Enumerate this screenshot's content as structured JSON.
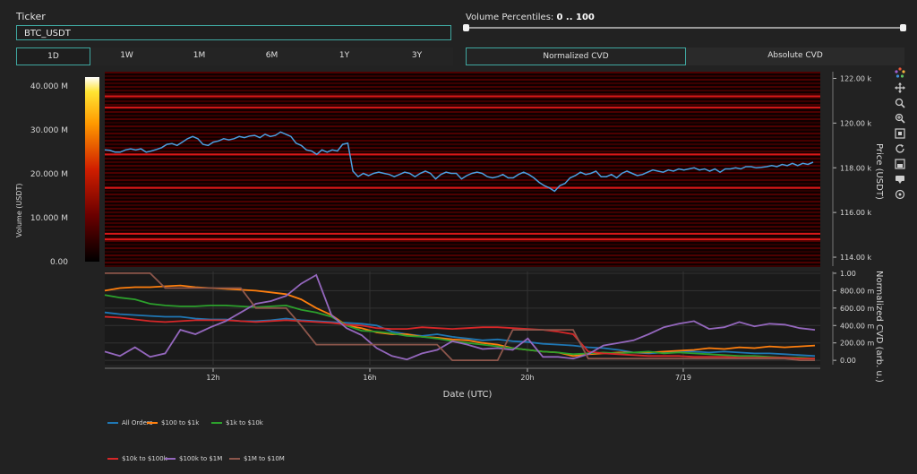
{
  "ticker": {
    "label": "Ticker",
    "value": "BTC_USDT"
  },
  "ranges": [
    "1D",
    "1W",
    "1M",
    "6M",
    "1Y",
    "3Y"
  ],
  "active_range": "1D",
  "volume_percentiles": {
    "label": "Volume Percentiles:",
    "value": "0 .. 100"
  },
  "cvd_modes": [
    "Normalized CVD",
    "Absolute CVD"
  ],
  "active_cvd_mode": "Normalized CVD",
  "toolbar_icons": [
    "plotly-logo-icon",
    "pan-icon",
    "zoom-icon",
    "zoom-in-icon",
    "autoscale-icon",
    "reset-icon",
    "download-icon",
    "hover-compare-icon",
    "spike-icon"
  ],
  "colors": {
    "accent": "#3fa7a0",
    "background": "#222222",
    "price_line": "#4a9fe0"
  },
  "chart_data": [
    {
      "type": "heatmap",
      "title": "",
      "xlabel": "",
      "ylabel": "Price (USDT)",
      "ylim": [
        113600,
        122300
      ],
      "y_ticks": [
        "114.00 k",
        "116.00 k",
        "118.00 k",
        "120.00 k",
        "122.00 k"
      ],
      "colorbar": {
        "label": "Volume (USDT)",
        "ticks": [
          "0.00",
          "10.000 M",
          "20.000 M",
          "30.000 M",
          "40.000 M"
        ],
        "range": [
          0,
          42000000
        ]
      },
      "series": [
        {
          "name": "",
          "values": [
            118.8,
            118.78,
            118.7,
            118.7,
            118.8,
            118.85,
            118.8,
            118.85,
            118.7,
            118.75,
            118.82,
            118.9,
            119.05,
            119.08,
            119.0,
            119.15,
            119.3,
            119.4,
            119.3,
            119.05,
            119.0,
            119.15,
            119.2,
            119.3,
            119.25,
            119.3,
            119.4,
            119.35,
            119.42,
            119.45,
            119.35,
            119.5,
            119.4,
            119.45,
            119.6,
            119.5,
            119.4,
            119.1,
            119.0,
            118.8,
            118.75,
            118.6,
            118.8,
            118.7,
            118.8,
            118.75,
            119.05,
            119.1,
            117.85,
            117.6,
            117.75,
            117.65,
            117.75,
            117.8,
            117.75,
            117.7,
            117.6,
            117.7,
            117.8,
            117.75,
            117.6,
            117.75,
            117.85,
            117.75,
            117.5,
            117.7,
            117.8,
            117.75,
            117.75,
            117.5,
            117.65,
            117.75,
            117.8,
            117.75,
            117.6,
            117.55,
            117.6,
            117.7,
            117.55,
            117.55,
            117.7,
            117.8,
            117.7,
            117.55,
            117.35,
            117.2,
            117.1,
            116.95,
            117.2,
            117.3,
            117.55,
            117.65,
            117.8,
            117.7,
            117.75,
            117.85,
            117.6,
            117.6,
            117.7,
            117.55,
            117.75,
            117.85,
            117.75,
            117.65,
            117.7,
            117.8,
            117.9,
            117.85,
            117.8,
            117.9,
            117.85,
            117.95,
            117.9,
            117.95,
            118.0,
            117.9,
            117.95,
            117.85,
            117.95,
            117.8,
            117.95,
            117.95,
            118.0,
            117.95,
            118.05,
            118.05,
            118.0,
            118.02,
            118.05,
            118.1,
            118.05,
            118.15,
            118.1,
            118.2,
            118.1,
            118.2,
            118.15,
            118.25
          ]
        }
      ],
      "bright_levels": [
        121.2,
        120.7,
        118.6,
        117.1,
        115.05,
        114.8
      ]
    },
    {
      "type": "line",
      "title": "",
      "xlabel": "Date (UTC)",
      "ylabel": "Normalized CVD (arb. u.)",
      "ylim": [
        -0.05,
        1.02
      ],
      "x_ticks": [
        "12h",
        "16h",
        "20h",
        "7/19"
      ],
      "y_ticks": [
        "0.00",
        "200.00 m",
        "400.00 m",
        "600.00 m",
        "800.00 m",
        "1.00"
      ],
      "series": [
        {
          "name": "All Orders",
          "color": "#1f77b4",
          "values": [
            0.55,
            0.53,
            0.52,
            0.51,
            0.5,
            0.5,
            0.48,
            0.47,
            0.47,
            0.45,
            0.45,
            0.46,
            0.48,
            0.46,
            0.45,
            0.44,
            0.43,
            0.42,
            0.4,
            0.33,
            0.3,
            0.28,
            0.3,
            0.27,
            0.25,
            0.23,
            0.24,
            0.22,
            0.21,
            0.19,
            0.18,
            0.17,
            0.15,
            0.14,
            0.12,
            0.09,
            0.08,
            0.09,
            0.1,
            0.1,
            0.09,
            0.1,
            0.09,
            0.08,
            0.08,
            0.07,
            0.06,
            0.05
          ]
        },
        {
          "name": "$100 to $1k",
          "color": "#ff7f0e",
          "values": [
            0.8,
            0.83,
            0.84,
            0.84,
            0.85,
            0.86,
            0.84,
            0.83,
            0.82,
            0.81,
            0.8,
            0.78,
            0.76,
            0.7,
            0.6,
            0.52,
            0.4,
            0.37,
            0.32,
            0.3,
            0.3,
            0.27,
            0.26,
            0.24,
            0.23,
            0.2,
            0.18,
            0.14,
            0.12,
            0.1,
            0.09,
            0.05,
            0.07,
            0.08,
            0.09,
            0.09,
            0.09,
            0.1,
            0.11,
            0.12,
            0.14,
            0.13,
            0.15,
            0.14,
            0.16,
            0.15,
            0.16,
            0.17
          ]
        },
        {
          "name": "$1k to $10k",
          "color": "#2ca02c",
          "values": [
            0.75,
            0.72,
            0.7,
            0.65,
            0.63,
            0.62,
            0.62,
            0.63,
            0.63,
            0.62,
            0.61,
            0.62,
            0.63,
            0.58,
            0.55,
            0.5,
            0.4,
            0.34,
            0.33,
            0.31,
            0.28,
            0.27,
            0.25,
            0.22,
            0.2,
            0.18,
            0.16,
            0.14,
            0.12,
            0.1,
            0.09,
            0.07,
            0.08,
            0.09,
            0.08,
            0.09,
            0.1,
            0.08,
            0.09,
            0.08,
            0.07,
            0.06,
            0.05,
            0.05,
            0.04,
            0.03,
            0.03,
            0.02
          ]
        },
        {
          "name": "$10k to $100k",
          "color": "#d62728",
          "values": [
            0.5,
            0.49,
            0.47,
            0.45,
            0.44,
            0.45,
            0.46,
            0.46,
            0.46,
            0.45,
            0.44,
            0.45,
            0.46,
            0.45,
            0.44,
            0.43,
            0.41,
            0.4,
            0.37,
            0.36,
            0.36,
            0.38,
            0.37,
            0.36,
            0.37,
            0.38,
            0.38,
            0.37,
            0.36,
            0.35,
            0.33,
            0.3,
            0.1,
            0.08,
            0.07,
            0.06,
            0.05,
            0.05,
            0.05,
            0.04,
            0.04,
            0.04,
            0.03,
            0.03,
            0.03,
            0.03,
            0.02,
            0.02
          ]
        },
        {
          "name": "$100k to $1M",
          "color": "#9467bd",
          "values": [
            0.1,
            0.05,
            0.15,
            0.04,
            0.08,
            0.35,
            0.3,
            0.38,
            0.45,
            0.55,
            0.65,
            0.68,
            0.74,
            0.88,
            0.98,
            0.52,
            0.37,
            0.29,
            0.14,
            0.05,
            0.01,
            0.08,
            0.12,
            0.22,
            0.18,
            0.13,
            0.14,
            0.12,
            0.25,
            0.04,
            0.04,
            0.02,
            0.07,
            0.17,
            0.2,
            0.23,
            0.3,
            0.38,
            0.42,
            0.45,
            0.36,
            0.38,
            0.44,
            0.39,
            0.42,
            0.41,
            0.37,
            0.35
          ]
        },
        {
          "name": "$1M to $10M",
          "color": "#8c564b",
          "values": [
            1.0,
            1.0,
            1.0,
            1.0,
            0.83,
            0.83,
            0.83,
            0.83,
            0.83,
            0.83,
            0.6,
            0.6,
            0.6,
            0.4,
            0.18,
            0.18,
            0.18,
            0.18,
            0.18,
            0.18,
            0.18,
            0.18,
            0.18,
            0.0,
            0.0,
            0.0,
            0.0,
            0.35,
            0.35,
            0.35,
            0.35,
            0.35,
            0.02,
            0.02,
            0.02,
            0.02,
            0.02,
            0.02,
            0.02,
            0.02,
            0.02,
            0.02,
            0.02,
            0.02,
            0.02,
            0.02,
            0.0,
            0.0
          ]
        }
      ]
    }
  ]
}
